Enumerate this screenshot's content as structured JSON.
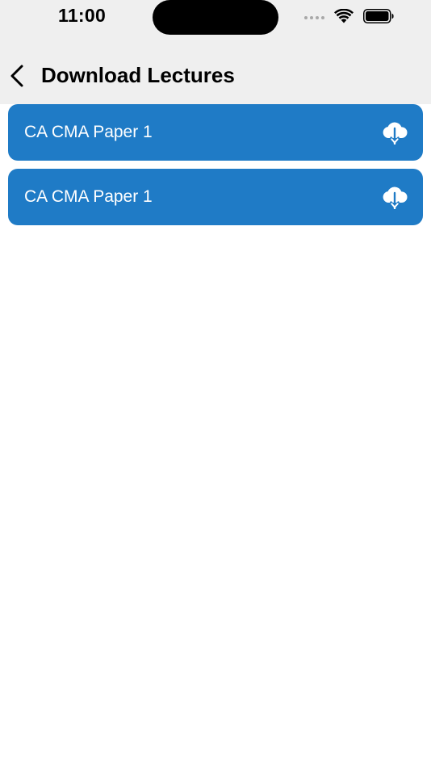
{
  "status_bar": {
    "time": "11:00",
    "icons": [
      "signal-dots-icon",
      "wifi-icon",
      "battery-icon"
    ]
  },
  "nav": {
    "back_icon": "chevron-left-icon",
    "title": "Download Lectures"
  },
  "lectures": [
    {
      "title": "CA CMA Paper 1",
      "action_icon": "cloud-download-icon"
    },
    {
      "title": "CA CMA Paper 1",
      "action_icon": "cloud-download-icon"
    }
  ],
  "colors": {
    "header_background": "#efefef",
    "item_background": "#1f7bc6",
    "item_text": "#ffffff",
    "page_background": "#ffffff"
  }
}
